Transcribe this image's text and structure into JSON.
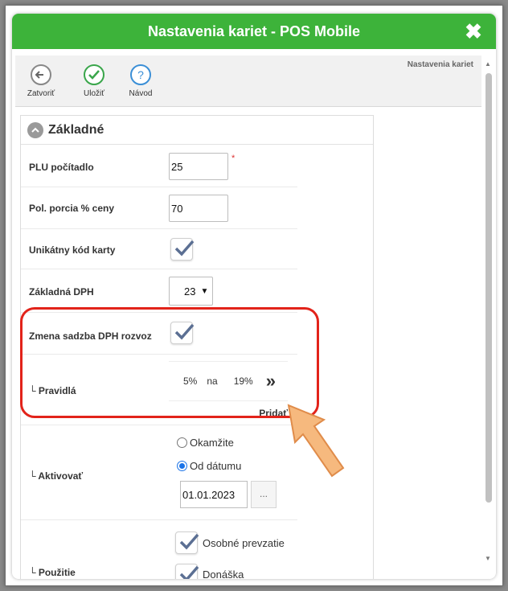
{
  "window": {
    "title": "Nastavenia kariet - POS Mobile",
    "close_icon": "close-icon"
  },
  "toolbar": {
    "breadcrumb": "Nastavenia kariet",
    "close_label": "Zatvoriť",
    "save_label": "Uložiť",
    "help_label": "Návod"
  },
  "section": {
    "title": "Základné"
  },
  "fields": {
    "plu_label": "PLU počítadlo",
    "plu_value": "25",
    "plu_required": "*",
    "portion_label": "Pol. porcia % ceny",
    "portion_value": "70",
    "unique_label": "Unikátny kód karty",
    "vat_label": "Základná DPH",
    "vat_value": "23",
    "vat_change_label": "Zmena sadzba DPH rozvoz",
    "rules_label": "└ Pravidlá",
    "rule_from": "5%",
    "rule_to_word": "na",
    "rule_to": "19%",
    "rule_more": "»",
    "add_label": "Pridať",
    "activate_label": "└ Aktivovať",
    "radio_now": "Okamžite",
    "radio_from_date": "Od dátumu",
    "date_value": "01.01.2023",
    "date_button": "...",
    "usage_label": "└ Použitie",
    "usage_pickup": "Osobné prevzatie",
    "usage_delivery": "Donáška"
  },
  "checkboxes": {
    "unique": true,
    "vat_change": true,
    "pickup": true,
    "delivery": true
  },
  "radios": {
    "selected": "from_date"
  },
  "colors": {
    "title_bg": "#3db33a",
    "highlight": "#e2231a",
    "arrow": "#f6b97e",
    "check": "#5b6f93"
  }
}
